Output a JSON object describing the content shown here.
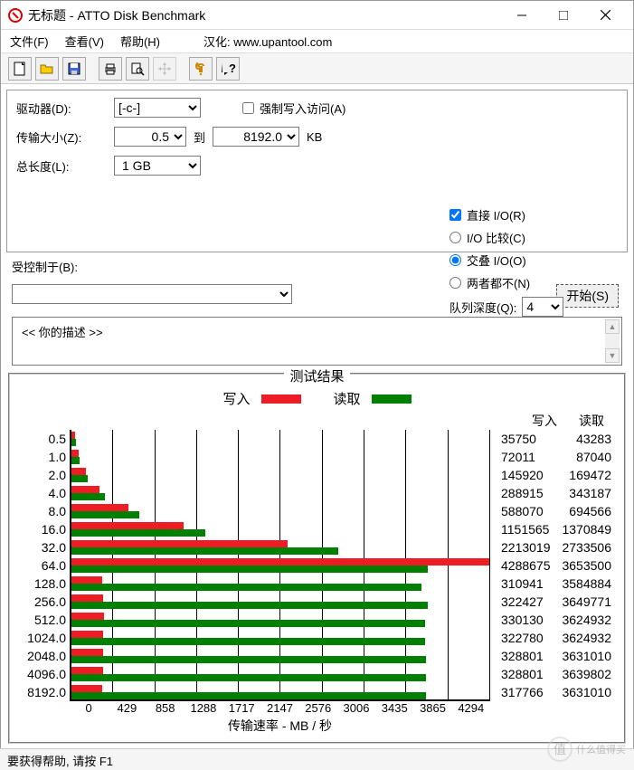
{
  "window": {
    "title": "无标题 - ATTO Disk Benchmark"
  },
  "menu": {
    "file": "文件(F)",
    "view": "查看(V)",
    "help": "帮助(H)",
    "localize": "汉化:",
    "url": "www.upantool.com"
  },
  "form": {
    "drive_label": "驱动器(D):",
    "drive_value": "[-c-]",
    "force_label": "强制写入访问(A)",
    "xfer_label": "传输大小(Z):",
    "xfer_from": "0.5",
    "xfer_to_label": "到",
    "xfer_to": "8192.0",
    "xfer_unit": "KB",
    "len_label": "总长度(L):",
    "len_value": "1 GB",
    "direct_label": "直接 I/O(R)",
    "io_compare": "I/O 比较(C)",
    "io_overlap": "交叠 I/O(O)",
    "io_neither": "两者都不(N)",
    "qd_label": "队列深度(Q):",
    "qd_value": "4",
    "controlled_label": "受控制于(B):",
    "start_label": "开始(S)",
    "desc_prefix": "<< 你的描述   >>"
  },
  "results": {
    "title": "测试结果",
    "write_label": "写入",
    "read_label": "读取",
    "xaxis_label": "传输速率 - MB / 秒"
  },
  "chart_data": {
    "type": "bar",
    "xlabel": "传输速率 - MB / 秒",
    "x_ticks": [
      0,
      429,
      858,
      1288,
      1717,
      2147,
      2576,
      3006,
      3435,
      3865,
      4294
    ],
    "x_max": 4294000,
    "series_names": [
      "写入",
      "读取"
    ],
    "rows": [
      {
        "size": "0.5",
        "write": 35750,
        "read": 43283
      },
      {
        "size": "1.0",
        "write": 72011,
        "read": 87040
      },
      {
        "size": "2.0",
        "write": 145920,
        "read": 169472
      },
      {
        "size": "4.0",
        "write": 288915,
        "read": 343187
      },
      {
        "size": "8.0",
        "write": 588070,
        "read": 694566
      },
      {
        "size": "16.0",
        "write": 1151565,
        "read": 1370849
      },
      {
        "size": "32.0",
        "write": 2213019,
        "read": 2733506
      },
      {
        "size": "64.0",
        "write": 4288675,
        "read": 3653500
      },
      {
        "size": "128.0",
        "write": 310941,
        "read": 3584884
      },
      {
        "size": "256.0",
        "write": 322427,
        "read": 3649771
      },
      {
        "size": "512.0",
        "write": 330130,
        "read": 3624932
      },
      {
        "size": "1024.0",
        "write": 322780,
        "read": 3624932
      },
      {
        "size": "2048.0",
        "write": 328801,
        "read": 3631010
      },
      {
        "size": "4096.0",
        "write": 328801,
        "read": 3639802
      },
      {
        "size": "8192.0",
        "write": 317766,
        "read": 3631010
      }
    ]
  },
  "status": {
    "text": "要获得帮助, 请按 F1"
  },
  "watermark": {
    "char": "值",
    "text": "什么值得买"
  }
}
